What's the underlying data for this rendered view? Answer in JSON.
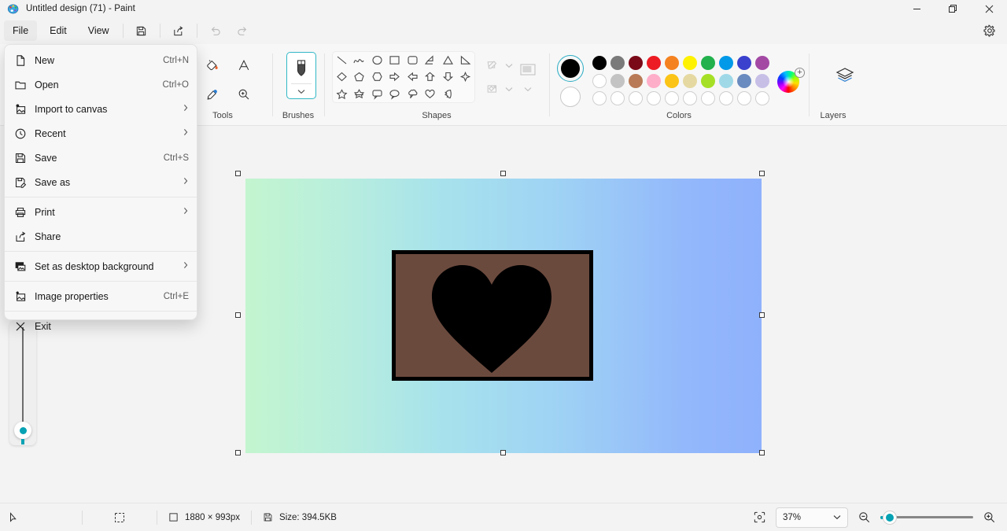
{
  "window": {
    "title": "Untitled design (71) - Paint",
    "app_icon": "paint-palette-icon",
    "controls": [
      {
        "name": "minimize",
        "icon": "minimize-icon"
      },
      {
        "name": "maximize",
        "icon": "restore-icon"
      },
      {
        "name": "close",
        "icon": "close-icon"
      }
    ]
  },
  "menubar": {
    "items": [
      {
        "label": "File",
        "active": true
      },
      {
        "label": "Edit",
        "active": false
      },
      {
        "label": "View",
        "active": false
      }
    ],
    "quick_actions": [
      {
        "name": "save-button",
        "icon": "floppy-disk-icon",
        "enabled": true
      },
      {
        "name": "share-button",
        "icon": "share-arrow-icon",
        "enabled": true
      },
      {
        "name": "undo-button",
        "icon": "undo-arrow-icon",
        "enabled": false
      },
      {
        "name": "redo-button",
        "icon": "redo-arrow-icon",
        "enabled": false
      }
    ],
    "settings": {
      "name": "settings-button",
      "icon": "gear-icon"
    }
  },
  "filemenu": {
    "open": true,
    "items": [
      {
        "label": "New",
        "icon": "new-document-icon",
        "accel": "Ctrl+N",
        "submenu": false
      },
      {
        "label": "Open",
        "icon": "folder-icon",
        "accel": "Ctrl+O",
        "submenu": false
      },
      {
        "label": "Import to canvas",
        "icon": "import-image-icon",
        "accel": "",
        "submenu": true
      },
      {
        "label": "Recent",
        "icon": "clock-icon",
        "accel": "",
        "submenu": true
      },
      {
        "label": "Save",
        "icon": "floppy-disk-icon",
        "accel": "Ctrl+S",
        "submenu": false
      },
      {
        "label": "Save as",
        "icon": "save-as-icon",
        "accel": "",
        "submenu": true
      },
      {
        "label": "Print",
        "icon": "printer-icon",
        "accel": "",
        "submenu": true
      },
      {
        "label": "Share",
        "icon": "share-arrow-icon",
        "accel": "",
        "submenu": false
      },
      {
        "label": "Set as desktop background",
        "icon": "desktop-background-icon",
        "accel": "",
        "submenu": true
      },
      {
        "label": "Image properties",
        "icon": "image-properties-icon",
        "accel": "Ctrl+E",
        "submenu": false
      },
      {
        "label": "Exit",
        "icon": "close-x-icon",
        "accel": "",
        "submenu": false
      }
    ],
    "separators_after": [
      5,
      7,
      8,
      9
    ]
  },
  "ribbon": {
    "groups": [
      {
        "key": "tools",
        "label": "Tools"
      },
      {
        "key": "brushes",
        "label": "Brushes"
      },
      {
        "key": "shapes",
        "label": "Shapes"
      },
      {
        "key": "colors",
        "label": "Colors"
      },
      {
        "key": "layers",
        "label": "Layers"
      }
    ],
    "tools": [
      {
        "name": "fill-bucket-tool",
        "icon": "paint-bucket-icon"
      },
      {
        "name": "text-tool",
        "icon": "letter-a-icon"
      },
      {
        "name": "eyedropper-tool",
        "icon": "eyedropper-icon"
      },
      {
        "name": "magnifier-tool",
        "icon": "magnifier-plus-icon"
      }
    ],
    "brushes": {
      "name": "brushes-button",
      "icon": "marker-brush-icon",
      "selected": true,
      "chevron": "chevron-down-icon"
    },
    "shapes": [
      "line-shape",
      "curve-shape",
      "oval-shape",
      "rectangle-shape",
      "rounded-rectangle-shape",
      "polygon-shape",
      "triangle-shape",
      "right-triangle-shape",
      "diamond-shape",
      "pentagon-shape",
      "hexagon-shape",
      "right-arrow-shape",
      "left-arrow-shape",
      "up-arrow-shape",
      "down-arrow-shape",
      "four-point-star-shape",
      "five-point-star-shape",
      "six-point-star-shape",
      "rounded-callout-shape",
      "oval-callout-shape",
      "cloud-callout-shape",
      "heart-shape",
      "lightning-shape"
    ],
    "shape_extras": [
      {
        "name": "outline-button",
        "icon": "pencil-outline-icon",
        "chevron": "chevron-down-icon"
      },
      {
        "name": "fill-button",
        "icon": "fill-paint-icon",
        "chevron": "chevron-down-icon"
      },
      {
        "name": "size-button",
        "icon": "stack-lines-icon",
        "chevron": "chevron-down-icon"
      }
    ],
    "colors": {
      "primary_swatch": "#000000",
      "secondary_swatch": "#ffffff",
      "row1": [
        "#000000",
        "#7a7a7a",
        "#7b0a18",
        "#ed1c24",
        "#f58220",
        "#fff200",
        "#22b14c",
        "#0199e8",
        "#3a41cd",
        "#a349a4"
      ],
      "row2": [
        "#ffffff",
        "#c3c3c3",
        "#b97a57",
        "#ffaec9",
        "#fbc417",
        "#e5d9a1",
        "#a6e026",
        "#9fd9e8",
        "#6a8bbf",
        "#c8bfe7"
      ],
      "row3": [
        "empty",
        "empty",
        "empty",
        "empty",
        "empty",
        "empty",
        "empty",
        "empty",
        "empty",
        "empty"
      ],
      "edit_colors": {
        "name": "color-wheel-button",
        "icon": "color-wheel-icon",
        "badge": "plus-icon"
      }
    },
    "layers": {
      "name": "layers-button",
      "icon": "layers-stack-icon"
    }
  },
  "canvas": {
    "gradient_from": "#c3f5cf",
    "gradient_to": "#8fb1fc",
    "selected": true,
    "artwork": {
      "frame_fill": "#6b4a3e",
      "frame_border": "#000000",
      "shape": "heart-shape",
      "shape_fill": "#000000"
    }
  },
  "brush_size_flyout": {
    "visible": true,
    "accent": "#06a2b3"
  },
  "statusbar": {
    "cursor_icon": "cursor-arrow-icon",
    "selection_icon": "selection-marquee-icon",
    "dimensions_icon": "canvas-size-icon",
    "dimensions": "1880 × 993px",
    "filesize_icon": "floppy-disk-icon",
    "filesize": "Size: 394.5KB",
    "fit_icon": "fit-to-window-icon",
    "zoom_value": "37%",
    "zoom_chevron": "chevron-down-icon",
    "zoom_out_icon": "magnifier-minus-icon",
    "zoom_in_icon": "magnifier-plus-icon"
  }
}
